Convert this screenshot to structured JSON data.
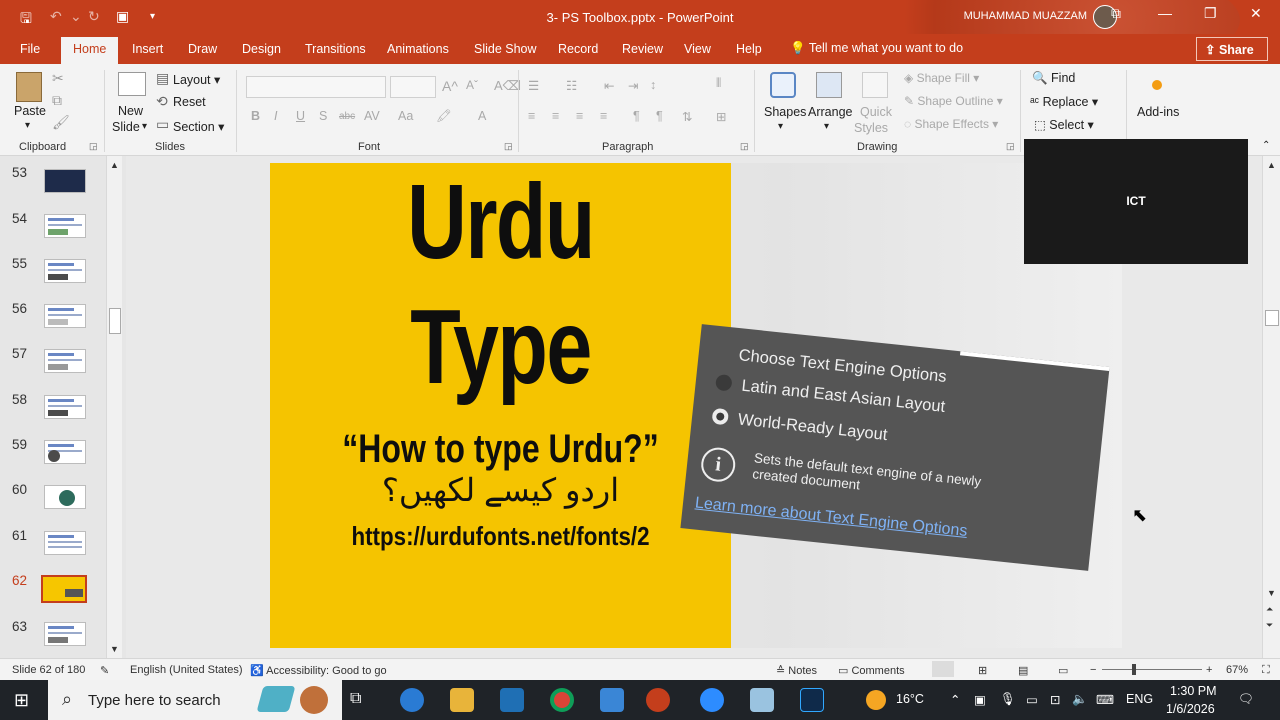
{
  "titlebar": {
    "doc_title": "3- PS Toolbox.pptx  -  PowerPoint",
    "user": "MUHAMMAD MUAZZAM",
    "minimize": "—",
    "restore": "❐",
    "close": "✕",
    "ribbon_display": "⧉"
  },
  "tabs": [
    "File",
    "Home",
    "Insert",
    "Draw",
    "Design",
    "Transitions",
    "Animations",
    "Slide Show",
    "Record",
    "Review",
    "View",
    "Help"
  ],
  "tellme": "Tell me what you want to do",
  "share": "Share",
  "ribbon": {
    "clipboard": {
      "paste": "Paste",
      "label": "Clipboard"
    },
    "slides": {
      "new_slide_1": "New",
      "new_slide_2": "Slide",
      "layout": "Layout",
      "reset": "Reset",
      "section": "Section",
      "label": "Slides"
    },
    "font": {
      "label": "Font"
    },
    "paragraph": {
      "label": "Paragraph"
    },
    "drawing": {
      "shapes": "Shapes",
      "arrange": "Arrange",
      "quick1": "Quick",
      "quick2": "Styles",
      "fill": "Shape Fill",
      "outline": "Shape Outline",
      "effects": "Shape Effects",
      "label": "Drawing"
    },
    "editing": {
      "find": "Find",
      "replace": "Replace",
      "select": "Select"
    },
    "addins": {
      "label": "Add-ins"
    }
  },
  "thumbnails": [
    {
      "num": "53"
    },
    {
      "num": "54"
    },
    {
      "num": "55"
    },
    {
      "num": "56"
    },
    {
      "num": "57"
    },
    {
      "num": "58"
    },
    {
      "num": "59"
    },
    {
      "num": "60"
    },
    {
      "num": "61"
    },
    {
      "num": "62",
      "selected": true
    },
    {
      "num": "63"
    }
  ],
  "slide": {
    "title_line1": "Urdu",
    "title_line2": "Type",
    "subtitle": "“How to type Urdu?”",
    "urdu_text": "اردو کیسے لکھیں؟",
    "url": "https://urdufonts.net/fonts/2"
  },
  "dialog": {
    "title": "Choose Text Engine Options",
    "option1": "Latin and East Asian Layout",
    "option2": "World-Ready Layout",
    "description": "Sets the default text engine of a newly created document",
    "link": "Learn more about Text Engine Options"
  },
  "zoom_video": {
    "label": "ICT"
  },
  "status": {
    "slide_counter": "Slide 62 of 180",
    "language": "English (United States)",
    "accessibility": "Accessibility: Good to go",
    "notes": "Notes",
    "comments": "Comments",
    "zoom": "67%",
    "zoom_level": 0.67
  },
  "taskbar": {
    "search_placeholder": "Type here to search",
    "temperature": "16°C",
    "lang": "ENG",
    "time": "1:30 PM",
    "date": "1/6/2026"
  },
  "colors": {
    "accent": "#c43e1c",
    "slide_yellow": "#f5c400",
    "dialog_bg": "#555555"
  }
}
